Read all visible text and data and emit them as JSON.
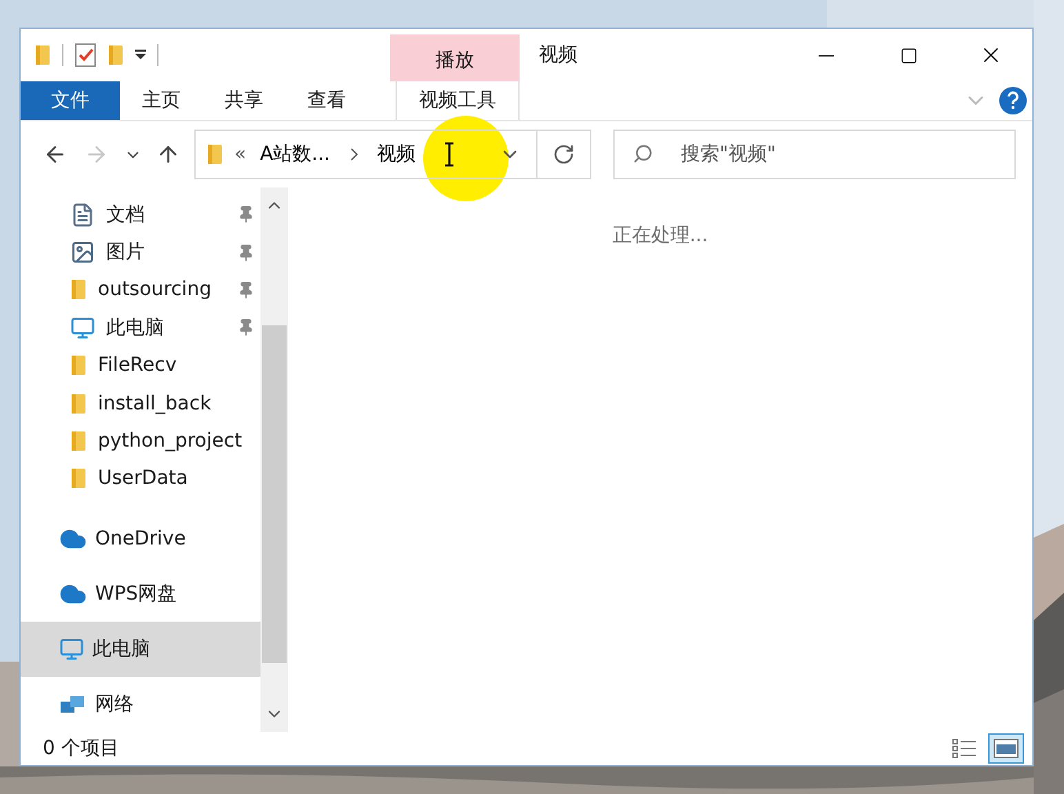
{
  "window": {
    "title": "视频",
    "context_group": "播放"
  },
  "quick_access": [
    {
      "kind": "folder"
    },
    {
      "kind": "properties"
    },
    {
      "kind": "new-folder"
    },
    {
      "kind": "customize"
    }
  ],
  "tabs": [
    {
      "label": "文件",
      "kind": "file",
      "selected": false
    },
    {
      "label": "主页",
      "kind": "plain",
      "selected": false
    },
    {
      "label": "共享",
      "kind": "plain",
      "selected": false
    },
    {
      "label": "查看",
      "kind": "plain",
      "selected": false
    },
    {
      "label": "视频工具",
      "kind": "contextual",
      "selected": false
    }
  ],
  "nav_buttons": [
    {
      "kind": "back",
      "disabled": false
    },
    {
      "kind": "forward",
      "disabled": true
    },
    {
      "kind": "recent",
      "disabled": false
    },
    {
      "kind": "up",
      "disabled": false
    }
  ],
  "address": {
    "overflow": "«",
    "segments": [
      "A站数...",
      "视频"
    ]
  },
  "search": {
    "placeholder": "搜索\"视频\""
  },
  "nav_pane": {
    "quick_access": [
      {
        "label": "文档",
        "kind": "documents",
        "pinned": true,
        "selected": false
      },
      {
        "label": "图片",
        "kind": "pictures",
        "pinned": true,
        "selected": false
      },
      {
        "label": "outsourcing",
        "kind": "folder",
        "pinned": true,
        "selected": false
      },
      {
        "label": "此电脑",
        "kind": "pc",
        "pinned": true,
        "selected": false
      },
      {
        "label": "FileRecv",
        "kind": "folder",
        "pinned": false,
        "selected": false
      },
      {
        "label": "install_back",
        "kind": "folder",
        "pinned": false,
        "selected": false
      },
      {
        "label": "python_project",
        "kind": "folder",
        "pinned": false,
        "selected": false
      },
      {
        "label": "UserData",
        "kind": "folder",
        "pinned": false,
        "selected": false
      }
    ],
    "locations": [
      {
        "label": "OneDrive",
        "kind": "cloud",
        "selected": false
      },
      {
        "label": "WPS网盘",
        "kind": "cloud",
        "selected": false
      },
      {
        "label": "此电脑",
        "kind": "pc",
        "selected": true
      },
      {
        "label": "网络",
        "kind": "network",
        "selected": false
      }
    ]
  },
  "content": {
    "message": "正在处理..."
  },
  "status_bar": {
    "count": "0 个项目",
    "view_buttons": [
      {
        "kind": "details",
        "selected": false
      },
      {
        "kind": "large-icons",
        "selected": true
      }
    ]
  }
}
